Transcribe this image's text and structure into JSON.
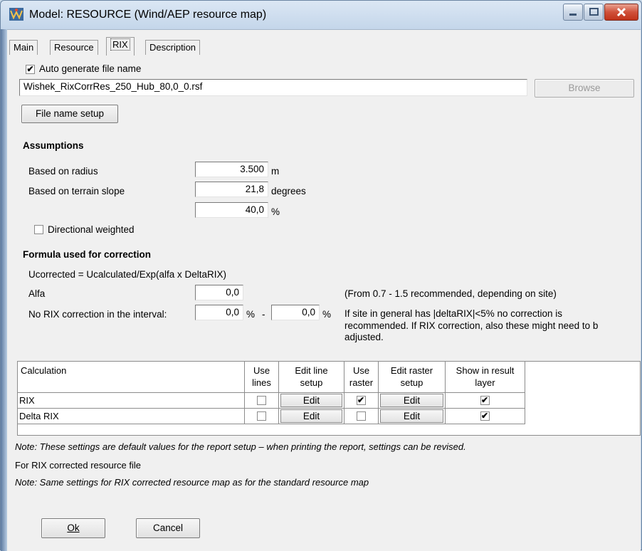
{
  "window": {
    "title": "Model: RESOURCE (Wind/AEP resource map)"
  },
  "tabs": [
    {
      "label": "Main"
    },
    {
      "label": "Resource"
    },
    {
      "label": "RIX"
    },
    {
      "label": "Description"
    }
  ],
  "file": {
    "auto_generate_label": "Auto generate file name",
    "auto_generate_checked": true,
    "file_name_value": "Wishek_RixCorrRes_250_Hub_80,0_0.rsf",
    "browse_label": "Browse",
    "file_name_setup_label": "File name setup"
  },
  "assumptions": {
    "heading": "Assumptions",
    "radius_label": "Based on radius",
    "radius_value": "3.500",
    "radius_unit": "m",
    "slope_label": "Based on terrain slope",
    "slope_value": "21,8",
    "slope_unit": "degrees",
    "percent_value": "40,0",
    "percent_unit": "%",
    "directional_label": "Directional weighted",
    "directional_checked": false
  },
  "formula": {
    "heading": "Formula used for correction",
    "equation": "Ucorrected = Ucalculated/Exp(alfa x DeltaRIX)",
    "alfa_label": "Alfa",
    "alfa_value": "0,0",
    "alfa_note": "(From 0.7 - 1.5 recommended, depending on site)",
    "interval_label": "No RIX correction in the interval:",
    "interval_from": "0,0",
    "interval_from_unit": "%",
    "interval_dash": "-",
    "interval_to": "0,0",
    "interval_to_unit": "%",
    "interval_note_1": "If site in general has |deltaRIX|<5% no correction is",
    "interval_note_2": "recommended. If RIX correction, also these might need to b",
    "interval_note_3": "adjusted."
  },
  "table": {
    "headers": {
      "calculation": "Calculation",
      "use_lines_1": "Use",
      "use_lines_2": "lines",
      "edit_line_1": "Edit line",
      "edit_line_2": "setup",
      "use_raster_1": "Use",
      "use_raster_2": "raster",
      "edit_raster_1": "Edit raster",
      "edit_raster_2": "setup",
      "show_1": "Show in result",
      "show_2": "layer"
    },
    "rows": [
      {
        "name": "RIX",
        "use_lines": false,
        "edit_line": "Edit",
        "use_raster": true,
        "edit_raster": "Edit",
        "show": true
      },
      {
        "name": "Delta RIX",
        "use_lines": false,
        "edit_line": "Edit",
        "use_raster": false,
        "edit_raster": "Edit",
        "show": true
      }
    ]
  },
  "notes": {
    "note_default": "Note: These settings are default values for the report setup – when printing the report, settings can be revised.",
    "for_rix": "For RIX corrected resource file",
    "note_same": "Note: Same settings for RIX corrected resource map as for the standard resource map"
  },
  "footer": {
    "ok_label": "Ok",
    "cancel_label": "Cancel"
  },
  "checkmark_glyph": "✔"
}
